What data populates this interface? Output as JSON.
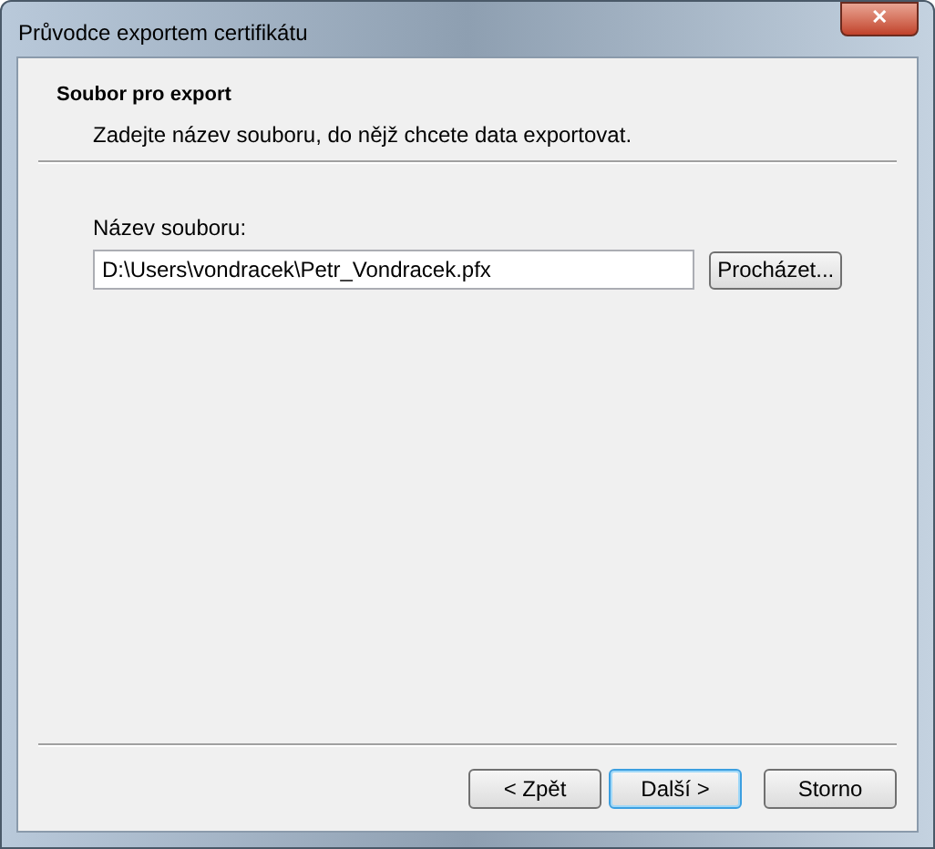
{
  "window": {
    "title": "Průvodce exportem certifikátu",
    "close": "✕"
  },
  "header": {
    "title": "Soubor pro export",
    "subtitle": "Zadejte název souboru, do nějž chcete data exportovat."
  },
  "file_field": {
    "label": "Název souboru:",
    "value": "D:\\Users\\vondracek\\Petr_Vondracek.pfx",
    "browse": "Procházet..."
  },
  "buttons": [
    {
      "label": "< Zpět",
      "default": false
    },
    {
      "label": "Další >",
      "default": true
    },
    {
      "label": "Storno",
      "default": false
    }
  ]
}
